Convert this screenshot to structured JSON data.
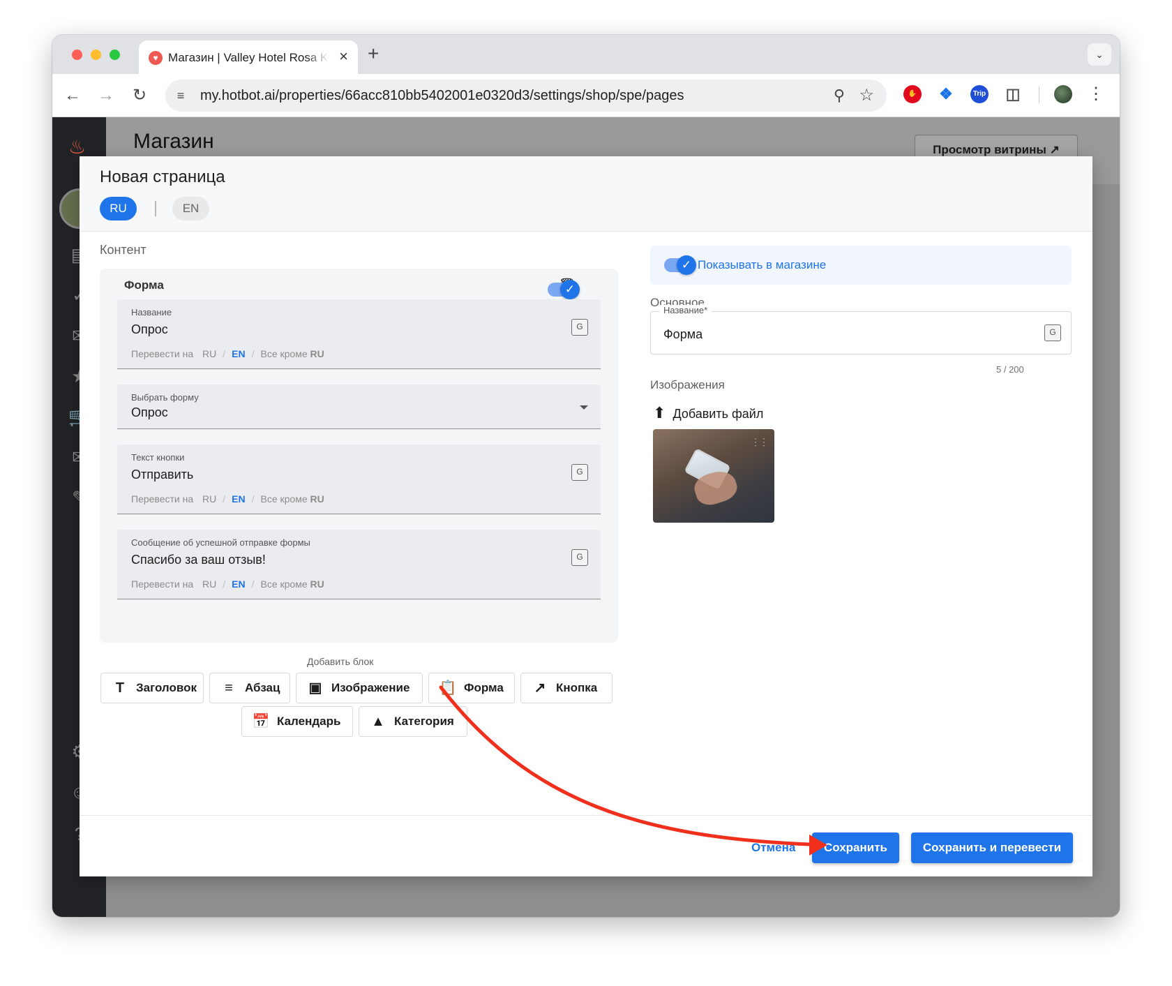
{
  "browser": {
    "tab_title": "Магазин | Valley Hotel Rosa K",
    "tab_close": "×",
    "new_tab": "+",
    "url": "my.hotbot.ai/properties/66acc810bb5402001e0320d3/settings/shop/spe/pages",
    "ext_trip_label": "Trip"
  },
  "background_page": {
    "title": "Магазин",
    "preview_button": "Просмотр витрины ↗"
  },
  "modal": {
    "title": "Новая страница",
    "languages": [
      "RU",
      "EN"
    ],
    "active_language": "RU",
    "content_label": "Контент",
    "block": {
      "title": "Форма",
      "enabled": true,
      "fields": [
        {
          "label": "Название",
          "value": "Опрос",
          "translate_prefix": "Перевести на",
          "ru": "RU",
          "en": "EN",
          "all_except_prefix": "Все кроме",
          "all_except_lang": "RU"
        },
        {
          "label": "Выбрать форму",
          "value": "Опрос"
        },
        {
          "label": "Текст кнопки",
          "value": "Отправить",
          "translate_prefix": "Перевести на",
          "ru": "RU",
          "en": "EN",
          "all_except_prefix": "Все кроме",
          "all_except_lang": "RU"
        },
        {
          "label": "Сообщение об успешной отправке формы",
          "value": "Спасибо за ваш отзыв!",
          "translate_prefix": "Перевести на",
          "ru": "RU",
          "en": "EN",
          "all_except_prefix": "Все кроме",
          "all_except_lang": "RU"
        }
      ]
    },
    "add_block_label": "Добавить блок",
    "add_block_buttons": [
      "Заголовок",
      "Абзац",
      "Изображение",
      "Форма",
      "Кнопка",
      "Календарь",
      "Категория"
    ],
    "show_in_shop_label": "Показывать в магазине",
    "show_in_shop": true,
    "basic_label": "Основное",
    "name_field_label": "Название*",
    "name_field_value": "Форма",
    "name_counter": "5 / 200",
    "images_label": "Изображения",
    "add_file_label": "Добавить файл",
    "footer": {
      "cancel": "Отмена",
      "save": "Сохранить",
      "save_translate": "Сохранить и перевести"
    }
  },
  "colors": {
    "accent": "#1e74e8",
    "annotation_arrow": "#f0301c"
  }
}
